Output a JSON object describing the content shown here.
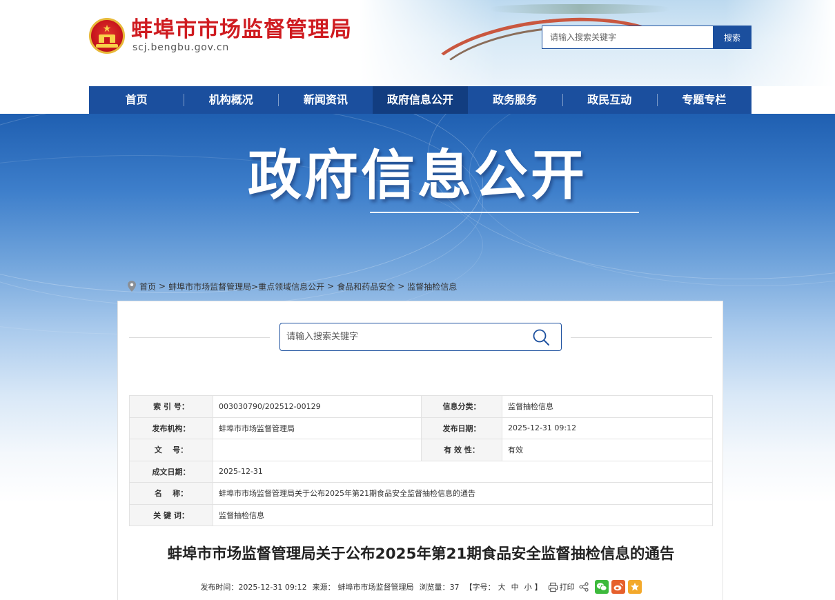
{
  "header": {
    "site_name": "蚌埠市市场监督管理局",
    "site_domain": "scj.bengbu.gov.cn",
    "search_placeholder": "请输入搜索关键字",
    "search_button": "搜索"
  },
  "nav": {
    "items": [
      "首页",
      "机构概况",
      "新闻资讯",
      "政府信息公开",
      "政务服务",
      "政民互动",
      "专题专栏"
    ],
    "active": "政府信息公开"
  },
  "banner": {
    "title": "政府信息公开"
  },
  "breadcrumb": {
    "items": [
      "首页",
      "蚌埠市市场监督管理局",
      ">重点领域信息公开",
      "食品和药品安全",
      "监督抽检信息"
    ],
    "separator": ">"
  },
  "content_search": {
    "placeholder": "请输入搜索关键字"
  },
  "info_table": {
    "index_label": "索 引 号：",
    "index_value": "003030790/202512-00129",
    "category_label": "信息分类：",
    "category_value": "监督抽检信息",
    "publisher_label": "发布机构：",
    "publisher_value": "蚌埠市市场监督管理局",
    "publish_date_label": "发布日期：",
    "publish_date_value": "2025-12-31 09:12",
    "doc_no_label": "文    号：",
    "doc_no_value": "",
    "validity_label": "有 效 性：",
    "validity_value": "有效",
    "created_label": "成文日期：",
    "created_value": "2025-12-31",
    "name_label": "名    称：",
    "name_value": "蚌埠市市场监督管理局关于公布2025年第21期食品安全监督抽检信息的通告",
    "keywords_label": "关 键 词：",
    "keywords_value": "监督抽检信息"
  },
  "article": {
    "title": "蚌埠市市场监督管理局关于公布2025年第21期食品安全监督抽检信息的通告",
    "publish_time_label": "发布时间：",
    "publish_time": "2025-12-31 09:12",
    "source_label": "来源：",
    "source": "蚌埠市市场监督管理局",
    "views_label": "浏览量：",
    "views": "37",
    "font_size_label": "【字号：",
    "font_large": "大",
    "font_medium": "中",
    "font_small": "小",
    "font_size_close": "】",
    "print_label": "打印"
  },
  "colors": {
    "brand_blue": "#1b4f9e",
    "nav_active": "#123d80",
    "site_name_red": "#cf1b20",
    "wechat_green": "#3dba3c",
    "weibo_orange": "#e6602c",
    "favorite_yellow": "#f3a92b"
  },
  "icons": {
    "emblem": "national-emblem-icon",
    "breadcrumb": "location-pin-icon",
    "search": "magnifier-icon",
    "print": "printer-icon",
    "share": "share-icon",
    "wechat": "wechat-icon",
    "weibo": "weibo-icon",
    "favorite": "star-icon"
  }
}
